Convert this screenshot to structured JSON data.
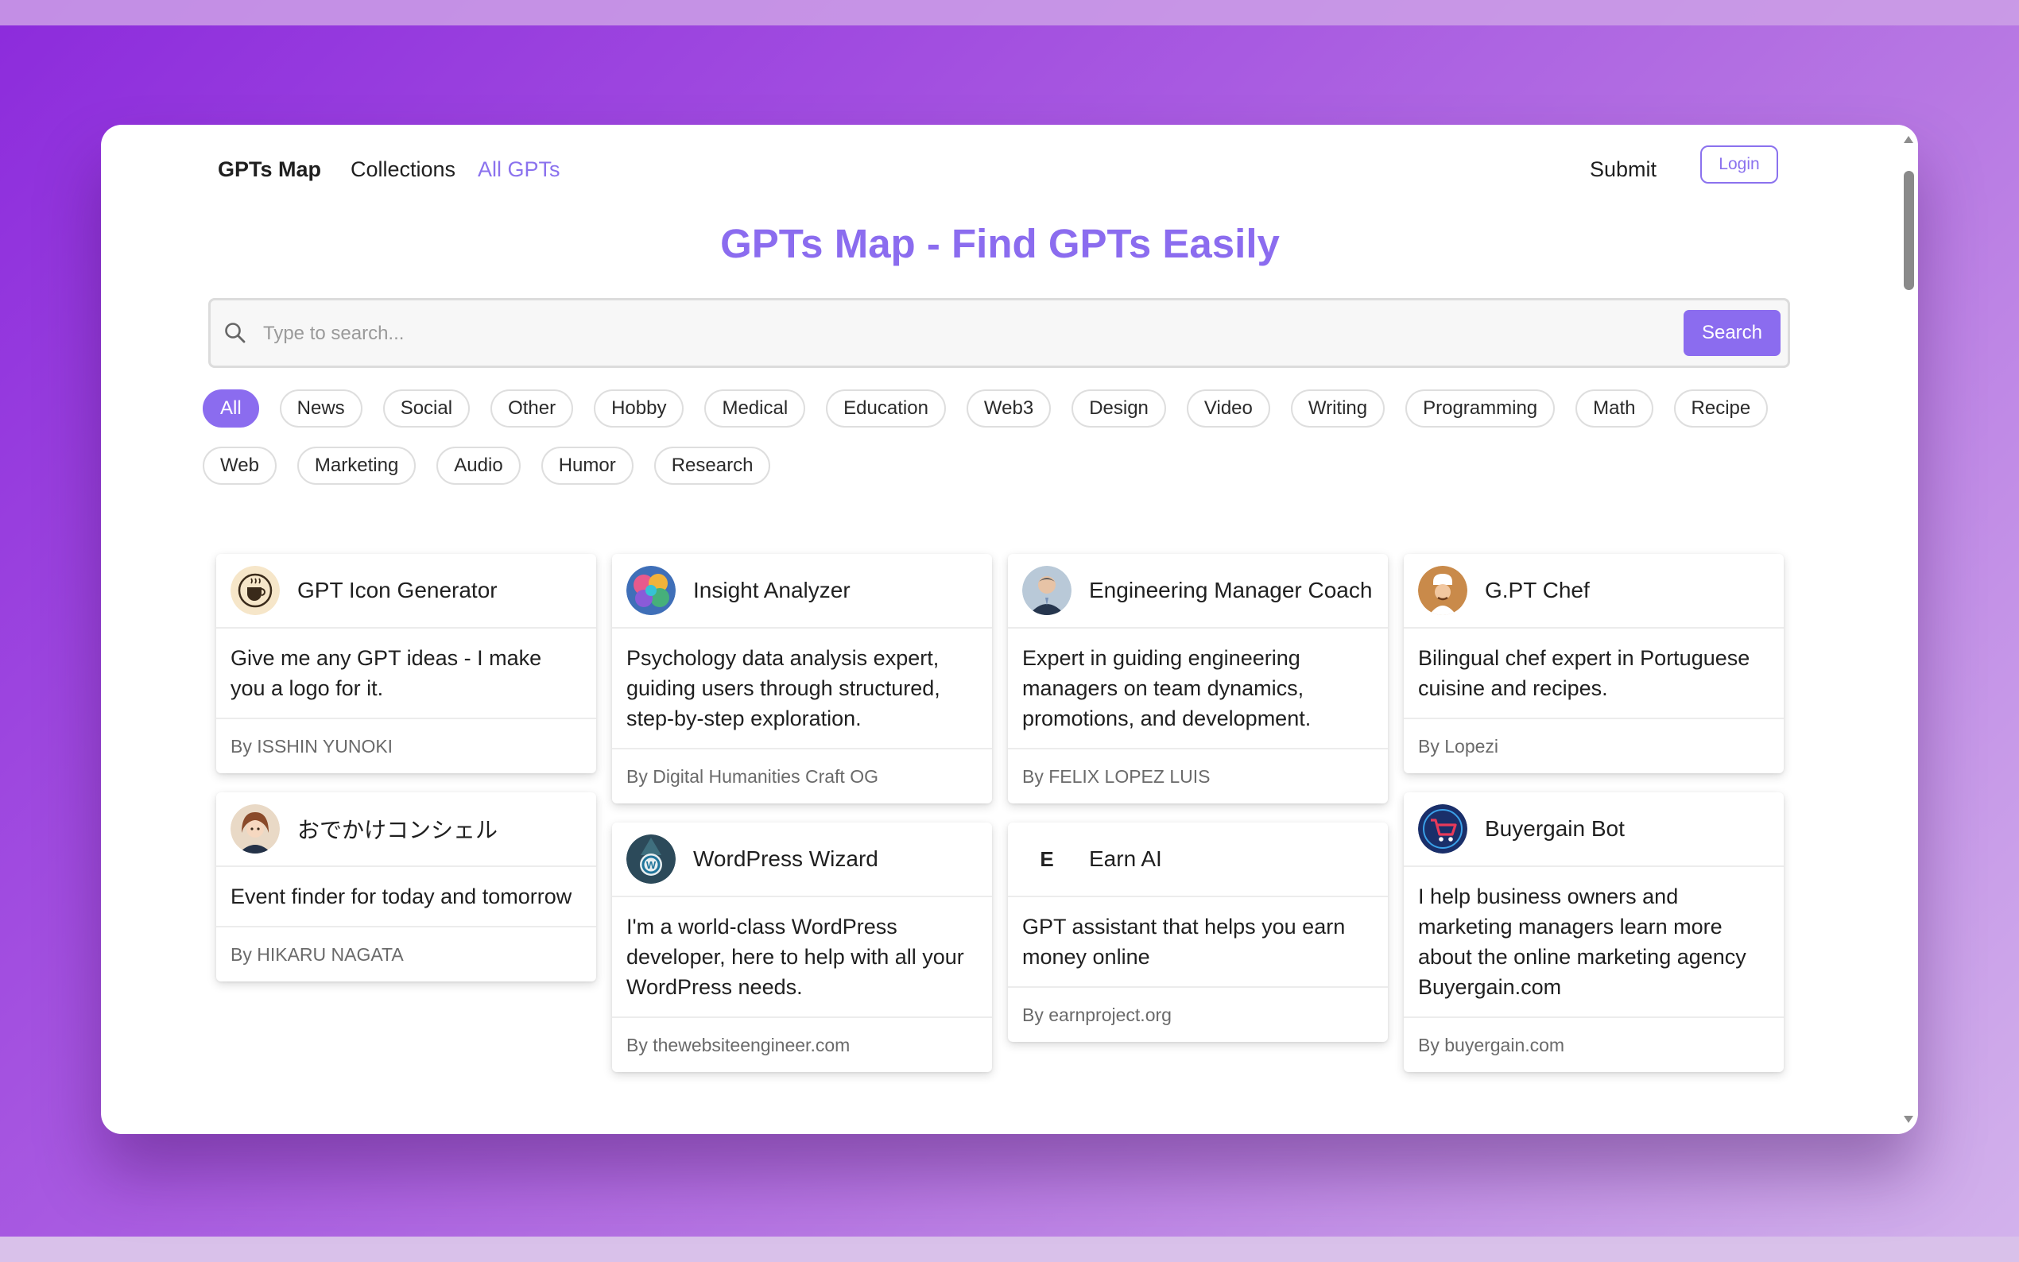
{
  "nav": {
    "brand": "GPTs Map",
    "collections": "Collections",
    "all_gpts": "All GPTs",
    "submit": "Submit",
    "login": "Login"
  },
  "page_title": "GPTs Map - Find GPTs Easily",
  "search": {
    "placeholder": "Type to search...",
    "button": "Search",
    "icon": "search-icon"
  },
  "categories": {
    "row1": [
      "All",
      "News",
      "Social",
      "Other",
      "Hobby",
      "Medical",
      "Education",
      "Web3",
      "Design",
      "Video",
      "Writing",
      "Programming",
      "Math",
      "Recipe"
    ],
    "row2": [
      "Web",
      "Marketing",
      "Audio",
      "Humor",
      "Research"
    ],
    "active": "All"
  },
  "colors": {
    "accent": "#8b6cef",
    "background_gradient_start": "#8c2bdc",
    "background_gradient_end": "#d3b3ec"
  },
  "cards": {
    "c1": {
      "name": "GPT Icon Generator",
      "description": "Give me any GPT ideas - I make you a logo for it.",
      "author": "By ISSHIN YUNOKI",
      "avatar": "coffee-cup-logo"
    },
    "c2": {
      "name": "Insight Analyzer",
      "description": "Psychology data analysis expert, guiding users through structured, step-by-step exploration.",
      "author": "By Digital Humanities Craft OG",
      "avatar": "colorful-brain"
    },
    "c3": {
      "name": "Engineering Manager Coach",
      "description": "Expert in guiding engineering managers on team dynamics, promotions, and development.",
      "author": "By FELIX LOPEZ LUIS",
      "avatar": "man-in-suit"
    },
    "c4": {
      "name": "G.PT Chef",
      "description": "Bilingual chef expert in Portuguese cuisine and recipes.",
      "author": "By Lopezi",
      "avatar": "chef"
    },
    "c5": {
      "name": "おでかけコンシェル",
      "description": "Event finder for today and tomorrow",
      "author": "By HIKARU NAGATA",
      "avatar": "anime-concierge"
    },
    "c6": {
      "name": "WordPress Wizard",
      "description": "I'm a world-class WordPress developer, here to help with all your WordPress needs.",
      "author": "By thewebsiteengineer.com",
      "avatar": "wizard-wordpress"
    },
    "c7": {
      "name": "Earn AI",
      "description": "GPT assistant that helps you earn money online",
      "author": "By earnproject.org",
      "avatar": "earn-logo",
      "avatar_text": "E"
    },
    "c8": {
      "name": "Buyergain Bot",
      "description": "I help business owners and marketing managers learn more about the online marketing agency Buyergain.com",
      "author": "By buyergain.com",
      "avatar": "shopping-cart"
    }
  }
}
